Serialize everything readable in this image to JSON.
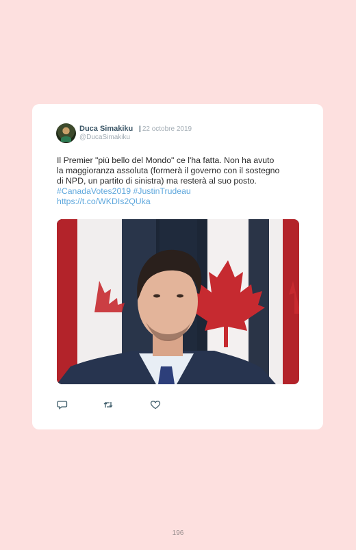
{
  "tweet": {
    "author_name": "Duca Simakiku",
    "date": "22 octobre 2019",
    "handle": "@DucaSimakiku",
    "text_line1": "Il Premier \"più bello del Mondo\" ce l'ha fatta. Non ha avuto",
    "text_line2": "la maggioranza assoluta (formerà il governo con il sostegno",
    "text_line3": "di NPD, un partito di sinistra) ma resterà al suo posto.",
    "hashtag1": "#CanadaVotes2019",
    "hashtag2": "#JustinTrudeau",
    "link": "https://t.co/WKDIs2QUka",
    "actions": {
      "reply_icon": "reply-icon",
      "retweet_icon": "retweet-icon",
      "like_icon": "heart-icon"
    }
  },
  "page_number": "196",
  "colors": {
    "page_background": "#fde0df",
    "card_background": "#ffffff",
    "link": "#5fa8dd",
    "icon": "#3b5a68"
  }
}
